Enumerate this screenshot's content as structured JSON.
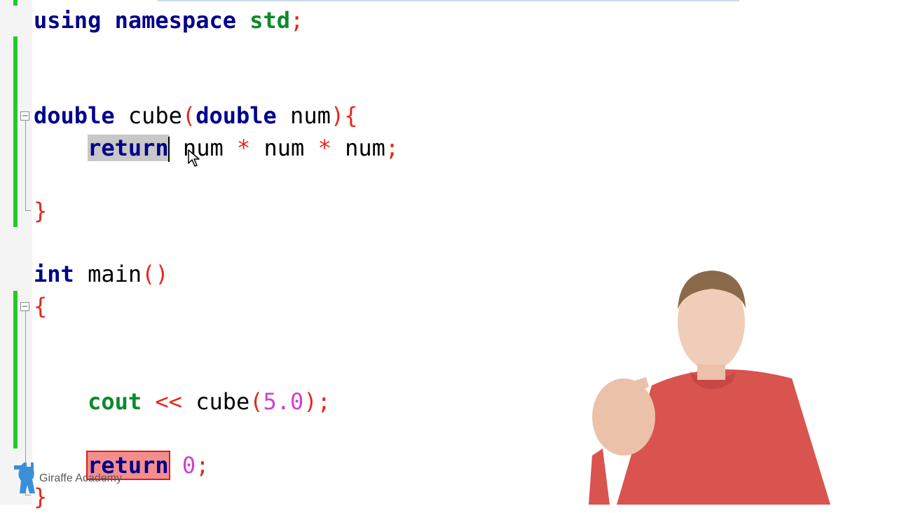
{
  "editor": {
    "lines": {
      "using": {
        "kw1": "using",
        "kw2": "namespace",
        "id": "std",
        "semi": ";"
      },
      "func_sig": {
        "type": "double",
        "name": "cube",
        "lparen": "(",
        "ptype": "double",
        "pname": "num",
        "rparen": ")",
        "brace": "{"
      },
      "func_body": {
        "kw": "return",
        "a": "num",
        "op1": "*",
        "b": "num",
        "op2": "*",
        "c": "num",
        "semi": ";"
      },
      "func_close": "}",
      "main_sig": {
        "type": "int",
        "name": "main",
        "parens": "()"
      },
      "main_open": "{",
      "cout": {
        "id": "cout",
        "op": "<<",
        "call": "cube",
        "lparen": "(",
        "arg": "5.0",
        "rparen": ")",
        "semi": ";"
      },
      "main_return": {
        "kw": "return",
        "val": "0",
        "semi": ";"
      },
      "main_close": "}"
    }
  },
  "watermark": {
    "text": "Giraffe Academy",
    "icon": "giraffe-logo-icon"
  },
  "colors": {
    "keyword": "#00008b",
    "std": "#0a8a2a",
    "operator": "#e8261a",
    "number": "#d040d0",
    "change_bar": "#22cc22",
    "selection": "#c8c8c8",
    "highlight_box": "#f58d8d"
  },
  "icons": [
    "fold-collapse-icon",
    "mouse-pointer-icon",
    "giraffe-logo-icon"
  ]
}
